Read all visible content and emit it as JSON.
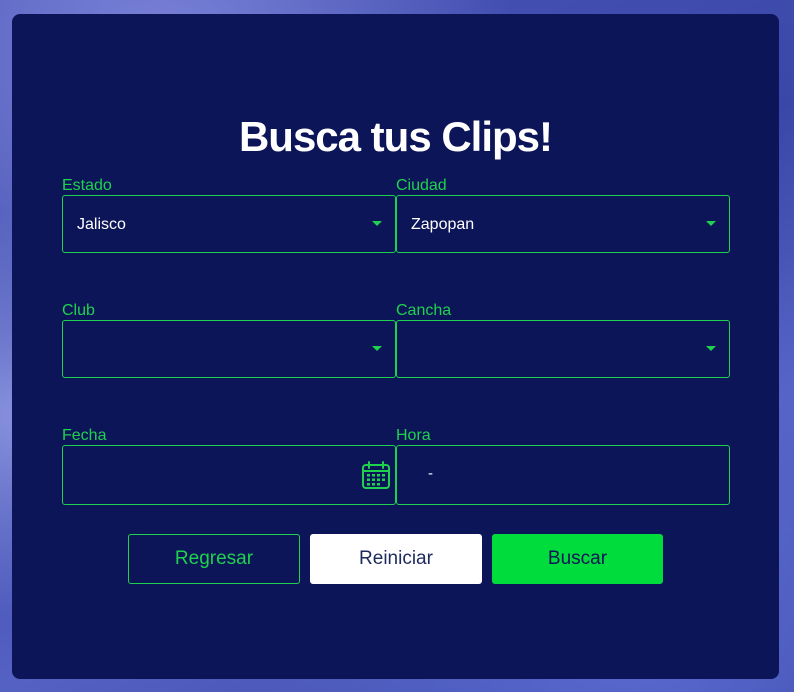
{
  "form": {
    "title": "Busca tus Clips!",
    "estado": {
      "label": "Estado",
      "value": "Jalisco"
    },
    "ciudad": {
      "label": "Ciudad",
      "value": "Zapopan"
    },
    "club": {
      "label": "Club",
      "value": ""
    },
    "cancha": {
      "label": "Cancha",
      "value": ""
    },
    "fecha": {
      "label": "Fecha",
      "value": ""
    },
    "hora": {
      "label": "Hora",
      "value": "-"
    }
  },
  "buttons": {
    "back_label": "Regresar",
    "reset_label": "Reiniciar",
    "search_label": "Buscar"
  },
  "colors": {
    "card_background": "#0b1558",
    "accent_green": "#1fd24e",
    "primary_button": "#00dc3c",
    "text_white": "#ffffff"
  },
  "icons": {
    "dropdown": "chevron-down-icon",
    "date": "calendar-icon"
  }
}
